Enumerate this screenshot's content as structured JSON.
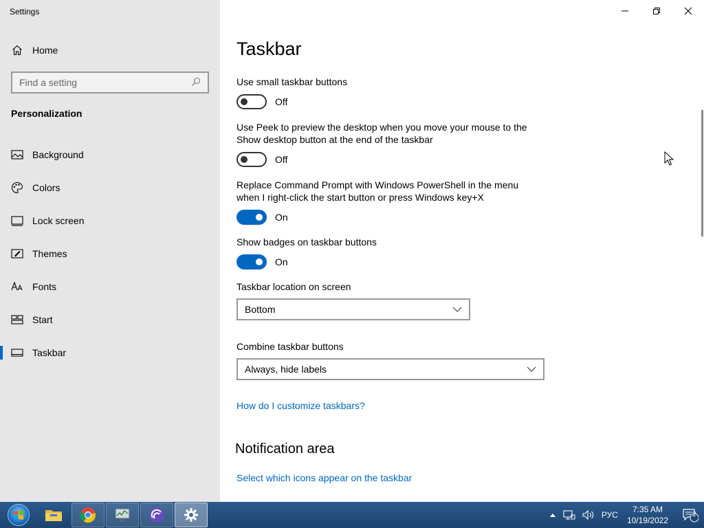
{
  "window": {
    "title": "Settings",
    "controls": {
      "minimize": "minimize",
      "maximize": "restore",
      "close": "close"
    }
  },
  "sidebar": {
    "home_label": "Home",
    "search_placeholder": "Find a setting",
    "section_title": "Personalization",
    "items": [
      {
        "label": "Background",
        "icon": "picture-icon"
      },
      {
        "label": "Colors",
        "icon": "palette-icon"
      },
      {
        "label": "Lock screen",
        "icon": "lock-screen-icon"
      },
      {
        "label": "Themes",
        "icon": "brush-icon"
      },
      {
        "label": "Fonts",
        "icon": "font-icon"
      },
      {
        "label": "Start",
        "icon": "start-icon"
      },
      {
        "label": "Taskbar",
        "icon": "taskbar-icon",
        "active": true
      }
    ]
  },
  "main": {
    "title": "Taskbar",
    "settings": [
      {
        "label": "Use small taskbar buttons",
        "state": "Off"
      },
      {
        "label": "Use Peek to preview the desktop when you move your mouse to the Show desktop button at the end of the taskbar",
        "state": "Off"
      },
      {
        "label": "Replace Command Prompt with Windows PowerShell in the menu when I right-click the start button or press Windows key+X",
        "state": "On"
      },
      {
        "label": "Show badges on taskbar buttons",
        "state": "On"
      }
    ],
    "location": {
      "label": "Taskbar location on screen",
      "value": "Bottom"
    },
    "combine": {
      "label": "Combine taskbar buttons",
      "value": "Always, hide labels"
    },
    "help_link": "How do I customize taskbars?",
    "notification_heading": "Notification area",
    "notification_link": "Select which icons appear on the taskbar"
  },
  "taskbar": {
    "apps": [
      "file-explorer-icon",
      "chrome-icon",
      "task-manager-icon",
      "bittorrent-icon",
      "settings-gear-icon"
    ],
    "language": "РУС",
    "time": "7:35 AM",
    "date": "10/19/2022",
    "notification_count": "2"
  },
  "colors": {
    "accent": "#0067c0",
    "sidebar_bg": "#e6e6e6",
    "taskbar_bg": "#1d4470"
  }
}
